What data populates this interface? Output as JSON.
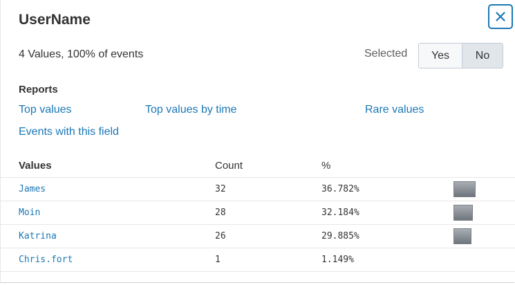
{
  "panel": {
    "title": "UserName",
    "summary": "4 Values, 100% of events",
    "selected_label": "Selected",
    "toggle": {
      "yes": "Yes",
      "no": "No",
      "active": "No"
    },
    "close_icon": "close-icon"
  },
  "reports": {
    "heading": "Reports",
    "links": [
      "Top values",
      "Top values by time",
      "Rare values",
      "Events with this field"
    ]
  },
  "table": {
    "headers": {
      "values": "Values",
      "count": "Count",
      "percent": "%"
    },
    "rows": [
      {
        "value": "James",
        "count": "32",
        "percent": "36.782%",
        "share": 36.782
      },
      {
        "value": "Moin",
        "count": "28",
        "percent": "32.184%",
        "share": 32.184
      },
      {
        "value": "Katrina",
        "count": "26",
        "percent": "29.885%",
        "share": 29.885
      },
      {
        "value": "Chris.fort",
        "count": "1",
        "percent": "1.149%",
        "share": 1.149
      }
    ]
  },
  "colors": {
    "accent": "#1a77b5",
    "text": "#333333",
    "bar": "#8a9098"
  }
}
